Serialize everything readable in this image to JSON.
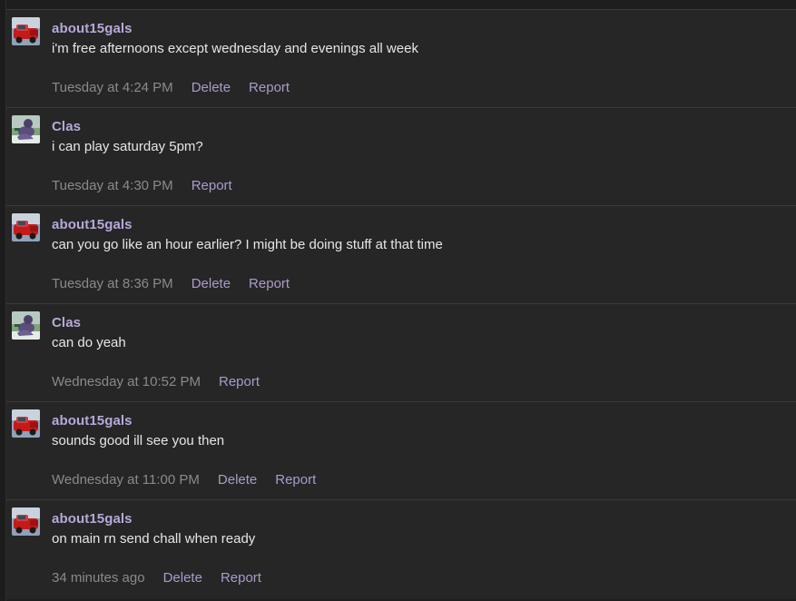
{
  "colors": {
    "background": "#1e1e1e",
    "message_bg": "#262626",
    "divider": "#3a3a3a",
    "username": "#b7a9d9",
    "body_text": "#e6e6e6",
    "timestamp": "#8a8a8a",
    "action_link": "#aa9bcc"
  },
  "messages": [
    {
      "username": "about15gals",
      "avatar": "red-car-avatar",
      "text": "i'm free afternoons except wednesday and evenings all week",
      "time": "Tuesday at 4:24 PM",
      "delete_label": "Delete",
      "report_label": "Report"
    },
    {
      "username": "Clas",
      "avatar": "purple-figure-avatar",
      "text": "i can play saturday 5pm?",
      "time": "Tuesday at 4:30 PM",
      "report_label": "Report"
    },
    {
      "username": "about15gals",
      "avatar": "red-car-avatar",
      "text": "can you go like an hour earlier? I might be doing stuff at that time",
      "time": "Tuesday at 8:36 PM",
      "delete_label": "Delete",
      "report_label": "Report"
    },
    {
      "username": "Clas",
      "avatar": "purple-figure-avatar",
      "text": "can do yeah",
      "time": "Wednesday at 10:52 PM",
      "report_label": "Report"
    },
    {
      "username": "about15gals",
      "avatar": "red-car-avatar",
      "text": "sounds good ill see you then",
      "time": "Wednesday at 11:00 PM",
      "delete_label": "Delete",
      "report_label": "Report"
    },
    {
      "username": "about15gals",
      "avatar": "red-car-avatar",
      "text": "on main rn send chall when ready",
      "time": "34 minutes ago",
      "delete_label": "Delete",
      "report_label": "Report"
    }
  ]
}
